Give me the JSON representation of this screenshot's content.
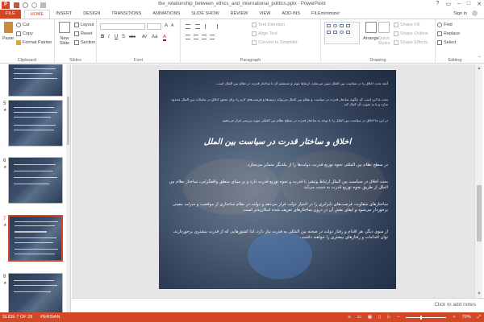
{
  "window": {
    "title": "the_relationship_between_ethics_and_international_politics.pptx - PowerPoint",
    "controls": [
      "?",
      "▭",
      "–",
      "□",
      "✕"
    ]
  },
  "tabs": [
    "FILE",
    "HOME",
    "INSERT",
    "DESIGN",
    "TRANSITIONS",
    "ANIMATIONS",
    "SLIDE SHOW",
    "REVIEW",
    "VIEW",
    "ADD-INS",
    "FILEminimizer"
  ],
  "active_tab": "HOME",
  "signin": "Sign in",
  "ribbon": {
    "clipboard": {
      "paste": "Paste",
      "cut": "Cut",
      "copy": "Copy",
      "format_painter": "Format Painter",
      "label": "Clipboard"
    },
    "slides": {
      "new_slide": "New Slide",
      "layout": "Layout",
      "reset": "Reset",
      "section": "Section",
      "label": "Slides"
    },
    "font": {
      "bold": "B",
      "italic": "I",
      "underline": "U",
      "strike": "S",
      "shadow": "abc",
      "spacing": "AV",
      "case": "Aa",
      "color": "A",
      "label": "Font"
    },
    "paragraph": {
      "text_direction": "Text Direction",
      "align_text": "Align Text",
      "smartart": "Convert to SmartArt",
      "label": "Paragraph"
    },
    "drawing": {
      "arrange": "Arrange",
      "quick_styles": "Quick Styles",
      "shape_fill": "Shape Fill",
      "shape_outline": "Shape Outline",
      "shape_effects": "Shape Effects",
      "label": "Drawing"
    },
    "editing": {
      "find": "Find",
      "replace": "Replace",
      "select": "Select",
      "label": "Editing"
    }
  },
  "thumbnails": [
    {
      "number": "",
      "star": ""
    },
    {
      "number": "5",
      "star": "★"
    },
    {
      "number": "6",
      "star": "★"
    },
    {
      "number": "7",
      "star": "★"
    },
    {
      "number": "8",
      "star": "★"
    }
  ],
  "slide": {
    "line1": "آنچه بحث اخلاق را در سیاست بین الملل تبیین می‌نماید، ارتباط موثر و مستقیم آن با ساختار قدرت در نظام بین الملل است.",
    "line2": "بحث ما این است که چگونه ساختار قدرت در سیاست و نظام بین الملل می‌تواند زمینه‌ها و فرصت‌های لازم را برای تحقق اخلاق در تعاملات بین الملل محدود سازد و یا به تقویت آن کمک کند.",
    "line3": "در این جا اخلاق در سیاست بین الملل را با توجه به ساختار قدرت در سطح نظام بین المللی مورد بررسی قرار می‌دهیم.",
    "title": "اخلاق و ساختار قدرت در سیاست بین الملل",
    "body1": "در سطح نظام بین المللی نحوه توزیع قدرت، دولت‌ها را از یکدیگر متمایز می‌سازد.",
    "body2": "بحث اخلاق در سیاست بین الملل ارتباط وثیقی با قدرت و نحوه توزیع قدرت دارد و بر مبنای منطق واقعگرایی، ساختار نظام بین الملل از طریق نحوه توزیع قدرت به دست می‌آید.",
    "body3": "ساختارهای متفاوت، فرصت‌های نابرابری را در اختیار دولت قرار می‌دهد و دولت در نظام ساختاری از موقعیت و منزلت معینی برخوردار می‌شود و ایفای نقش آن در درون ساختارهای تعریف شده امکان‌پذیر است.",
    "body4": "از سوی دیگر، هر اقدام و رفتار دولت در صحنه بین المللی به قدرت نیاز دارد، لذا کشورهایی که از قدرت بیشتری برخوردارند، توان اقدامات و رفتارهای بیشتری را خواهند داشت."
  },
  "notes_placeholder": "Click to add notes",
  "status": {
    "slide": "SLIDE 7 OF 28",
    "language": "PERSIAN",
    "notes": "≡",
    "zoom": "70%"
  },
  "colors": {
    "accent": "#d24726"
  }
}
